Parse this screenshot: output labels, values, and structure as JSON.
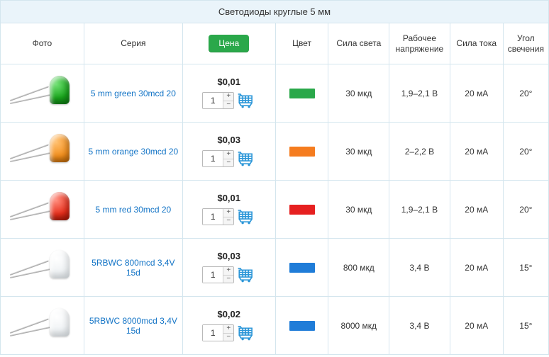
{
  "table": {
    "title": "Светодиоды круглые 5 мм",
    "headers": {
      "photo": "Фото",
      "series": "Серия",
      "price_badge": "Цена",
      "color": "Цвет",
      "intensity": "Сила света",
      "voltage": "Рабочее напряжение",
      "current": "Сила тока",
      "angle": "Угол свечения"
    },
    "rows": [
      {
        "led_color": "green",
        "series": "5 mm green 30mcd 20",
        "price": "$0,01",
        "qty": "1",
        "swatch": "sw-green",
        "intensity": "30 мкд",
        "voltage": "1,9–2,1 В",
        "current": "20 мА",
        "angle": "20°"
      },
      {
        "led_color": "orange",
        "series": "5 mm orange 30mcd 20",
        "price": "$0,03",
        "qty": "1",
        "swatch": "sw-orange",
        "intensity": "30 мкд",
        "voltage": "2–2,2 В",
        "current": "20 мА",
        "angle": "20°"
      },
      {
        "led_color": "red",
        "series": "5 mm red 30mcd 20",
        "price": "$0,01",
        "qty": "1",
        "swatch": "sw-red",
        "intensity": "30 мкд",
        "voltage": "1,9–2,1 В",
        "current": "20 мА",
        "angle": "20°"
      },
      {
        "led_color": "white",
        "series": "5RBWC 800mcd 3,4V 15d",
        "price": "$0,03",
        "qty": "1",
        "swatch": "sw-blue",
        "intensity": "800 мкд",
        "voltage": "3,4 В",
        "current": "20 мА",
        "angle": "15°"
      },
      {
        "led_color": "white",
        "series": "5RBWC 8000mcd 3,4V 15d",
        "price": "$0,02",
        "qty": "1",
        "swatch": "sw-blue",
        "intensity": "8000 мкд",
        "voltage": "3,4 В",
        "current": "20 мА",
        "angle": "15°"
      }
    ]
  }
}
